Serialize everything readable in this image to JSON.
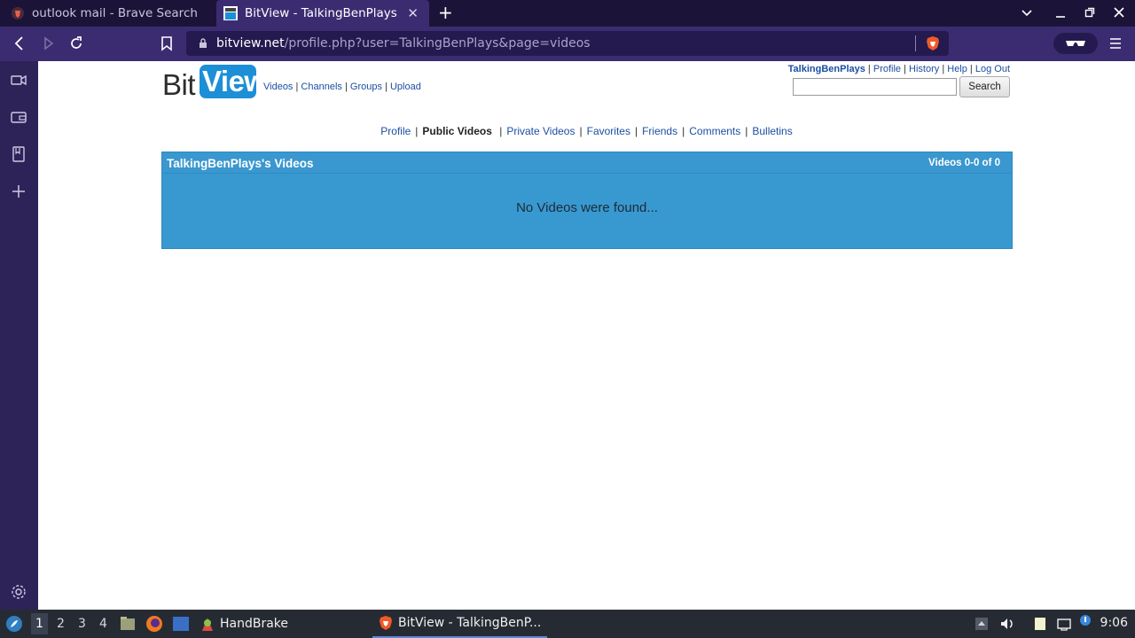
{
  "browser": {
    "tabs": [
      {
        "title": "outlook mail - Brave Search",
        "active": false
      },
      {
        "title": "BitView - TalkingBenPlays",
        "active": true
      }
    ],
    "address": {
      "host": "bitview.net",
      "path": "/profile.php?user=TalkingBenPlays&page=videos"
    }
  },
  "site": {
    "logo": {
      "bit": "Bit",
      "view": "View"
    },
    "top_nav": [
      "Videos",
      "Channels",
      "Groups",
      "Upload"
    ],
    "user_nav": {
      "username": "TalkingBenPlays",
      "links": [
        "Profile",
        "History",
        "Help",
        "Log Out"
      ]
    },
    "search": {
      "value": "",
      "button_label": "Search"
    },
    "profile_tabs": [
      {
        "label": "Profile",
        "current": false
      },
      {
        "label": "Public Videos",
        "current": true
      },
      {
        "label": "Private Videos",
        "current": false
      },
      {
        "label": "Favorites",
        "current": false
      },
      {
        "label": "Friends",
        "current": false
      },
      {
        "label": "Comments",
        "current": false
      },
      {
        "label": "Bulletins",
        "current": false
      }
    ],
    "videos_panel": {
      "title": "TalkingBenPlays's Videos",
      "count": "Videos 0-0 of 0",
      "empty_message": "No Videos were found..."
    }
  },
  "taskbar": {
    "workspaces": [
      "1",
      "2",
      "3",
      "4"
    ],
    "current_workspace": "1",
    "tasks": [
      {
        "label": "HandBrake",
        "icon": "handbrake-icon",
        "active": false
      },
      {
        "label": "BitView - TalkingBenP...",
        "icon": "brave-icon",
        "active": true
      }
    ],
    "clock": "9:06"
  },
  "colors": {
    "tabbar_bg": "#1b1438",
    "navbar_bg": "#3b2c72",
    "sidebar_bg": "#2d2358",
    "panel_blue": "#3899d0",
    "link_blue": "#1c4ea1",
    "taskbar_bg": "#262b33"
  }
}
